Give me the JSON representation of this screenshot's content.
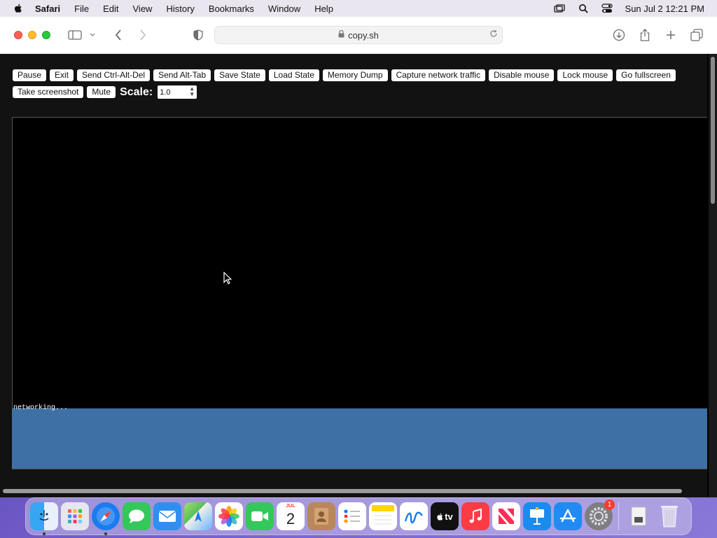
{
  "menubar": {
    "app_name": "Safari",
    "items": [
      "File",
      "Edit",
      "View",
      "History",
      "Bookmarks",
      "Window",
      "Help"
    ],
    "clock": "Sun Jul 2  12:21 PM"
  },
  "browser": {
    "address": "copy.sh"
  },
  "controls": {
    "buttons": [
      "Pause",
      "Exit",
      "Send Ctrl-Alt-Del",
      "Send Alt-Tab",
      "Save State",
      "Load State",
      "Memory Dump",
      "Capture network traffic",
      "Disable mouse",
      "Lock mouse",
      "Go fullscreen",
      "Take screenshot",
      "Mute"
    ],
    "scale_label": "Scale:",
    "scale_value": "1.0"
  },
  "emulator": {
    "status_text": "networking..."
  },
  "dock": {
    "items": [
      "Finder",
      "Launchpad",
      "Safari",
      "Messages",
      "Mail",
      "Maps",
      "Photos",
      "FaceTime",
      "Calendar",
      "Contacts",
      "Reminders",
      "Notes",
      "Freeform",
      "TV",
      "Music",
      "News",
      "Keynote",
      "App Store",
      "System Settings",
      "Downloads",
      "Trash"
    ],
    "calendar_month": "JUL",
    "calendar_day": "2",
    "tv_label": "tv",
    "settings_badge": "1"
  }
}
